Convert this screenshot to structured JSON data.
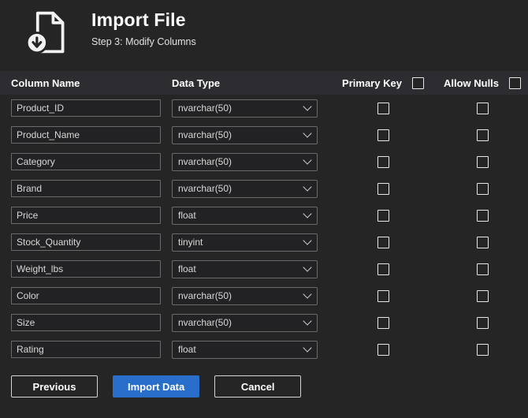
{
  "header": {
    "title": "Import File",
    "subtitle": "Step 3: Modify Columns",
    "icon": "import-file-document-download-icon"
  },
  "table": {
    "headers": {
      "column_name": "Column Name",
      "data_type": "Data Type",
      "primary_key": "Primary Key",
      "allow_nulls": "Allow Nulls"
    },
    "select_all": {
      "primary_key_checked": false,
      "allow_nulls_checked": false
    },
    "rows": [
      {
        "name": "Product_ID",
        "type": "nvarchar(50)",
        "primary_key": false,
        "allow_nulls": false
      },
      {
        "name": "Product_Name",
        "type": "nvarchar(50)",
        "primary_key": false,
        "allow_nulls": false
      },
      {
        "name": "Category",
        "type": "nvarchar(50)",
        "primary_key": false,
        "allow_nulls": false
      },
      {
        "name": "Brand",
        "type": "nvarchar(50)",
        "primary_key": false,
        "allow_nulls": false
      },
      {
        "name": "Price",
        "type": "float",
        "primary_key": false,
        "allow_nulls": false
      },
      {
        "name": "Stock_Quantity",
        "type": "tinyint",
        "primary_key": false,
        "allow_nulls": false
      },
      {
        "name": "Weight_lbs",
        "type": "float",
        "primary_key": false,
        "allow_nulls": false
      },
      {
        "name": "Color",
        "type": "nvarchar(50)",
        "primary_key": false,
        "allow_nulls": false
      },
      {
        "name": "Size",
        "type": "nvarchar(50)",
        "primary_key": false,
        "allow_nulls": false
      },
      {
        "name": "Rating",
        "type": "float",
        "primary_key": false,
        "allow_nulls": false
      }
    ]
  },
  "buttons": {
    "previous": "Previous",
    "import": "Import Data",
    "cancel": "Cancel"
  },
  "colors": {
    "background": "#252526",
    "header_row": "#2d2d31",
    "accent_blue": "#2a6ecb",
    "control_border": "#6b6b6b"
  }
}
